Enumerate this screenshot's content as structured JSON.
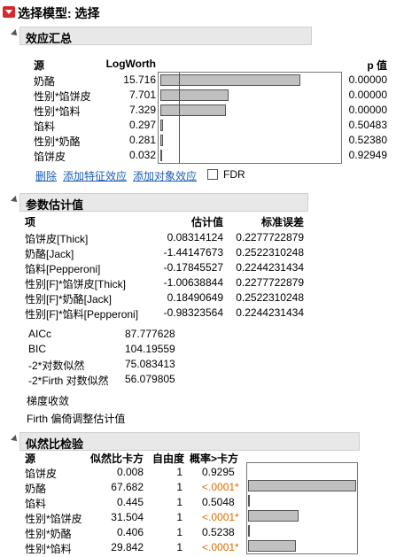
{
  "window": {
    "title": "选择模型: 选择"
  },
  "effect_summary": {
    "title": "效应汇总",
    "headers": {
      "source": "源",
      "logworth": "LogWorth",
      "pvalue": "p 值"
    },
    "rows": [
      {
        "source": "奶酪",
        "logworth": "15.716",
        "pvalue": "0.00000",
        "fraction": 1.0
      },
      {
        "source": "性别*馅饼皮",
        "logworth": "7.701",
        "pvalue": "0.00000",
        "fraction": 0.49
      },
      {
        "source": "性别*馅料",
        "logworth": "7.329",
        "pvalue": "0.00000",
        "fraction": 0.466
      },
      {
        "source": "馅料",
        "logworth": "0.297",
        "pvalue": "0.50483",
        "fraction": 0.019
      },
      {
        "source": "性别*奶酪",
        "logworth": "0.281",
        "pvalue": "0.52380",
        "fraction": 0.018
      },
      {
        "source": "馅饼皮",
        "logworth": "0.032",
        "pvalue": "0.92949",
        "fraction": 0.002
      }
    ],
    "reference_line_fraction": 0.133,
    "actions": {
      "remove": "删除",
      "add_feature": "添加特征效应",
      "add_subject": "添加对象效应",
      "fdr": "FDR"
    }
  },
  "param_estimates": {
    "title": "参数估计值",
    "headers": {
      "term": "项",
      "estimate": "估计值",
      "stderr": "标准误差"
    },
    "rows": [
      {
        "term": "馅饼皮[Thick]",
        "estimate": "0.08314124",
        "stderr": "0.2277722879"
      },
      {
        "term": "奶酪[Jack]",
        "estimate": "-1.44147673",
        "stderr": "0.2522310248"
      },
      {
        "term": "馅料[Pepperoni]",
        "estimate": "-0.17845527",
        "stderr": "0.2244231434"
      },
      {
        "term": "性别[F]*馅饼皮[Thick]",
        "estimate": "-1.00638844",
        "stderr": "0.2277722879"
      },
      {
        "term": "性别[F]*奶酪[Jack]",
        "estimate": "0.18490649",
        "stderr": "0.2522310248"
      },
      {
        "term": "性别[F]*馅料[Pepperoni]",
        "estimate": "-0.98323564",
        "stderr": "0.2244231434"
      }
    ],
    "stats": [
      {
        "label": "AICc",
        "value": "87.777628"
      },
      {
        "label": "BIC",
        "value": "104.19559"
      },
      {
        "label": "-2*对数似然",
        "value": "75.083413"
      },
      {
        "label": "-2*Firth 对数似然",
        "value": "56.079805"
      }
    ],
    "notes": [
      "梯度收敛",
      "Firth 偏倚调整估计值"
    ]
  },
  "lr_test": {
    "title": "似然比检验",
    "headers": {
      "source": "源",
      "chisq": "似然比卡方",
      "df": "自由度",
      "prob": "概率>卡方"
    },
    "rows": [
      {
        "source": "馅饼皮",
        "chisq": "0.008",
        "df": "1",
        "prob": "0.9295",
        "sig": false,
        "fraction": 0.0
      },
      {
        "source": "奶酪",
        "chisq": "67.682",
        "df": "1",
        "prob": "<.0001*",
        "sig": true,
        "fraction": 1.0
      },
      {
        "source": "馅料",
        "chisq": "0.445",
        "df": "1",
        "prob": "0.5048",
        "sig": false,
        "fraction": 0.0066
      },
      {
        "source": "性别*馅饼皮",
        "chisq": "31.504",
        "df": "1",
        "prob": "<.0001*",
        "sig": true,
        "fraction": 0.465
      },
      {
        "source": "性别*奶酪",
        "chisq": "0.406",
        "df": "1",
        "prob": "0.5238",
        "sig": false,
        "fraction": 0.006
      },
      {
        "source": "性别*馅料",
        "chisq": "29.842",
        "df": "1",
        "prob": "<.0001*",
        "sig": true,
        "fraction": 0.441
      }
    ],
    "colors": {
      "significant": "#e06c00"
    }
  }
}
